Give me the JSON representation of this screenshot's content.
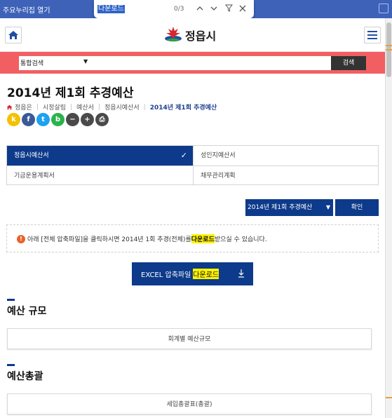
{
  "browser": {
    "favorites_label": "주요누리집 열기",
    "find": {
      "query": "다운로드",
      "count": "0/3"
    }
  },
  "site": {
    "logo_text": "정읍시",
    "search": {
      "category": "통합검색",
      "button": "검색"
    }
  },
  "page": {
    "title": "2014년 제1회 추경예산",
    "breadcrumb": [
      "정읍은",
      "시정살림",
      "예산서",
      "정읍시예산서",
      "2014년 제1회 추경예산"
    ]
  },
  "share_icons": [
    {
      "name": "kakaostory-icon",
      "glyph": "k",
      "color": "#f2c200"
    },
    {
      "name": "facebook-icon",
      "glyph": "f",
      "color": "#3b5998"
    },
    {
      "name": "twitter-icon",
      "glyph": "t",
      "color": "#1da1f2"
    },
    {
      "name": "band-icon",
      "glyph": "b",
      "color": "#2bb24c"
    },
    {
      "name": "zoom-out-icon",
      "glyph": "−",
      "color": "#4a4a4a"
    },
    {
      "name": "zoom-in-icon",
      "glyph": "+",
      "color": "#4a4a4a"
    },
    {
      "name": "print-icon",
      "glyph": "⎙",
      "color": "#4a4a4a"
    }
  ],
  "tabs": [
    {
      "label": "정읍시예산서",
      "active": true
    },
    {
      "label": "성인지예산서",
      "active": false
    },
    {
      "label": "기금운용계획서",
      "active": false
    },
    {
      "label": "채무관리계획",
      "active": false
    }
  ],
  "year_select": {
    "value": "2014년 제1회 추경예산",
    "confirm": "확인"
  },
  "notice": {
    "before": "아래 [전체 압축파일]을 클릭하시면 2014년 1회 추경(전체)를 ",
    "highlight": "다운로드",
    "after": " 받으실 수 있습니다."
  },
  "excel_button": {
    "label": "EXCEL 압축파일",
    "highlight": "다운로드"
  },
  "sections": [
    {
      "title": "예산 규모",
      "box": "회계별 예산규모"
    },
    {
      "title": "예산총괄",
      "box": "세입총괄표(총괄)"
    }
  ],
  "colors": {
    "primary": "#0d3a8a",
    "search_band": "#f25f63",
    "highlight": "#fff200"
  }
}
